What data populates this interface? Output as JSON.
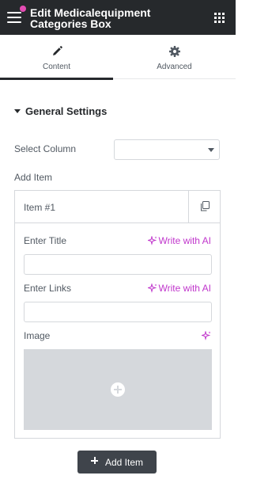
{
  "header": {
    "title": "Edit Medicalequipment Categories Box",
    "menu_icon": "hamburger-icon",
    "apps_icon": "grid-icon",
    "accent": "#e34cb3"
  },
  "tabs": [
    {
      "label": "Content",
      "icon": "pencil-icon",
      "active": true
    },
    {
      "label": "Advanced",
      "icon": "gear-icon",
      "active": false
    }
  ],
  "section": {
    "title": "General Settings"
  },
  "select_column": {
    "label": "Select Column",
    "value": ""
  },
  "add_item_label": "Add Item",
  "item": {
    "title": "Item #1",
    "fields": {
      "title_label": "Enter Title",
      "title_value": "",
      "links_label": "Enter Links",
      "links_value": "",
      "image_label": "Image"
    },
    "ai_label": "Write with AI"
  },
  "add_button": {
    "label": "Add Item"
  },
  "colors": {
    "header_bg": "#26292c",
    "ai": "#c036cc",
    "button_bg": "#3f444b"
  }
}
